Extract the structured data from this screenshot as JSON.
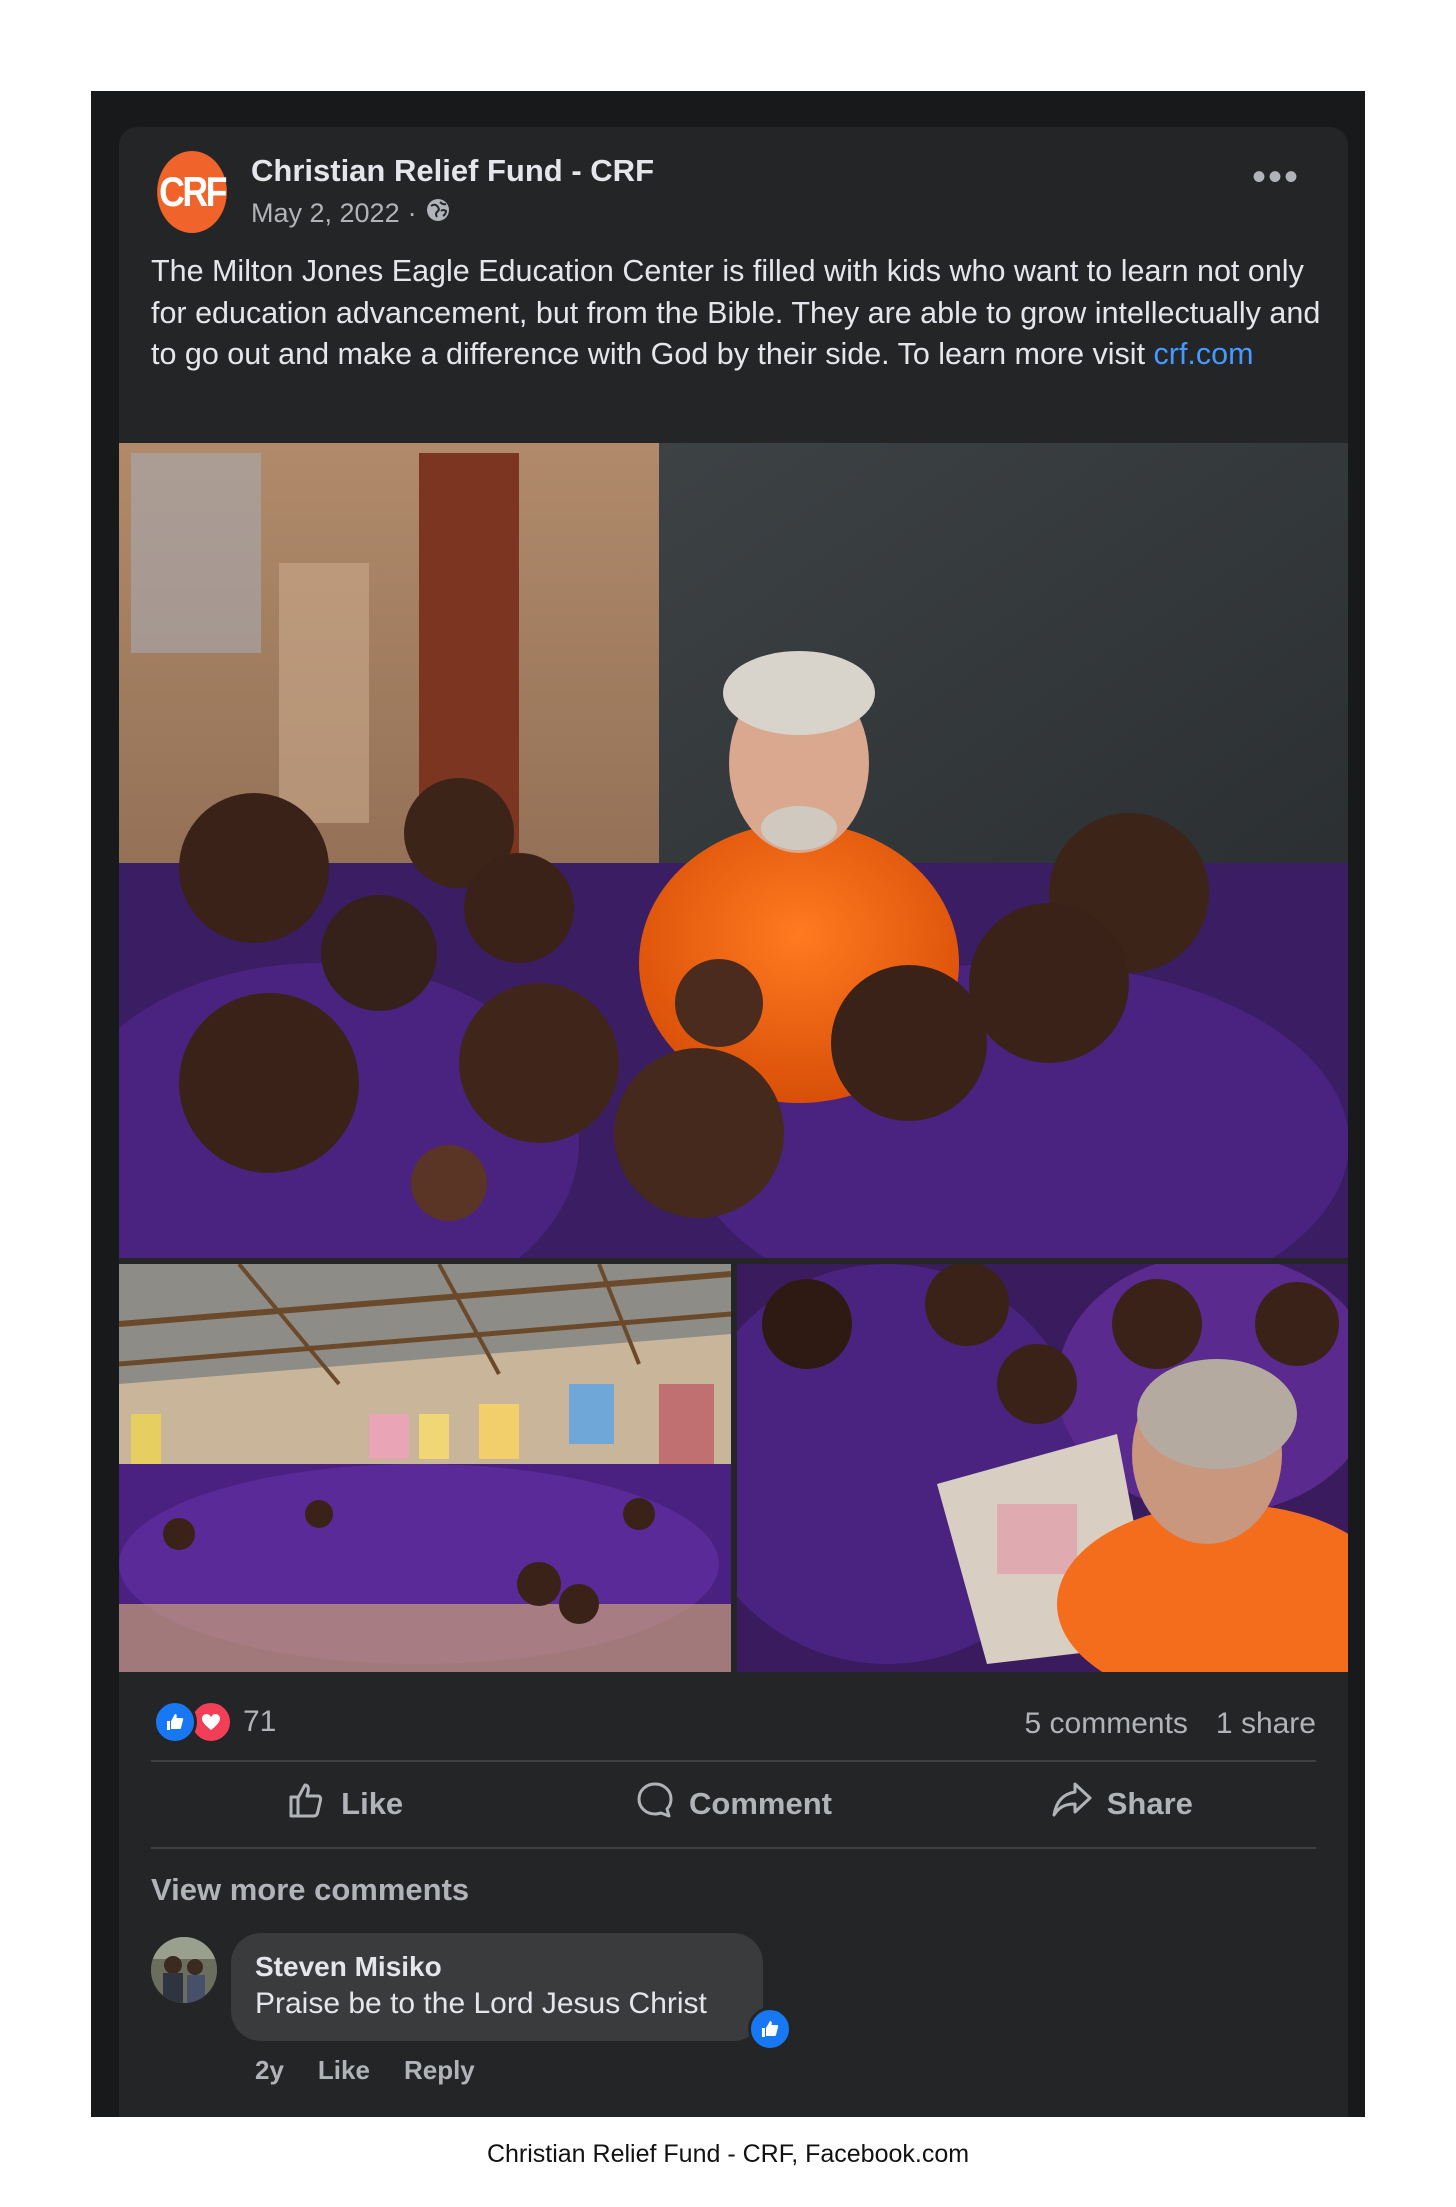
{
  "post": {
    "page_name": "Christian Relief Fund - CRF",
    "avatar_text": "CRF",
    "date": "May 2, 2022",
    "separator": "·",
    "privacy_icon": "globe-icon",
    "more_icon": "more-options-icon",
    "more_label": "•••",
    "text": "The Milton Jones Eagle Education Center is filled with kids who want to learn not only for education advancement, but from the Bible. They are able to grow intellectually and to go out and make a difference with God by their side. To learn more visit ",
    "link": "crf.com"
  },
  "photos": [
    {
      "id": "main",
      "subject": "group-photo-classroom"
    },
    {
      "id": "bottom-left",
      "subject": "classroom-students-waving"
    },
    {
      "id": "bottom-right",
      "subject": "students-reading-book"
    }
  ],
  "stats": {
    "reaction_count": "71",
    "comments": "5 comments",
    "shares": "1 share"
  },
  "actions": {
    "like": "Like",
    "comment": "Comment",
    "share": "Share"
  },
  "comments": {
    "view_more": "View more comments",
    "items": [
      {
        "author": "Steven Misiko",
        "text": "Praise be to the Lord Jesus Christ",
        "age": "2y",
        "like": "Like",
        "reply": "Reply"
      }
    ]
  },
  "caption": "Christian Relief Fund - CRF, Facebook.com",
  "colors": {
    "background": "#242526",
    "accent_link": "#4599ff",
    "like_blue": "#1877f2",
    "love_red": "#f33e58",
    "brand_orange": "#f0632a"
  }
}
